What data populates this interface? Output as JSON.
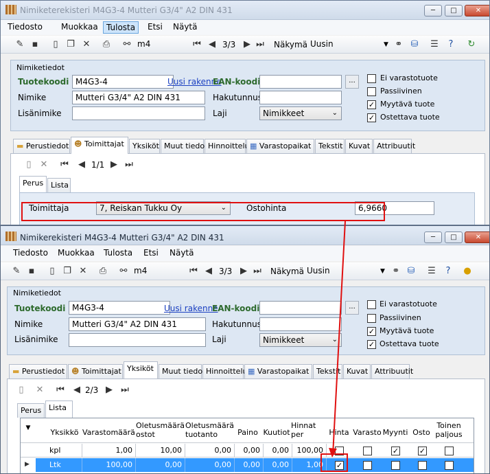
{
  "windows": [
    {
      "title": "Nimiketerekisteri M4G3-4 Mutteri G3/4\" A2 DIN 431",
      "menu": [
        "Tiedosto",
        "Muokkaa",
        "Tulosta",
        "Etsi",
        "Näytä"
      ],
      "toolbar": {
        "search": "m4",
        "pager": "3/3",
        "view_label": "Näkymä",
        "view_value": "Uusin"
      },
      "group_title": "Nimiketiedot",
      "product_code_label": "Tuotekoodi",
      "product_code": "M4G3-4",
      "new_structure": "Uusi rakenne",
      "ean_label": "EAN-koodi",
      "name_label": "Nimike",
      "name": "Mutteri G3/4\" A2 DIN 431",
      "search_name_label": "Hakutunnus",
      "extra_name_label": "Lisänimike",
      "type_label": "Laji",
      "type_value": "Nimikkeet",
      "checks": [
        {
          "label": "Ei varastotuote",
          "checked": false
        },
        {
          "label": "Passiivinen",
          "checked": false
        },
        {
          "label": "Myytävä tuote",
          "checked": true
        },
        {
          "label": "Ostettava tuote",
          "checked": true
        }
      ],
      "tabs": [
        "Perustiedot",
        "Toimittajat",
        "Yksiköt",
        "Muut tiedot",
        "Hinnoittelu",
        "Varastopaikat",
        "Tekstit",
        "Kuvat",
        "Attribuutit"
      ],
      "subpager": "1/1",
      "subtabs": [
        "Perus",
        "Lista"
      ],
      "supplier_label": "Toimittaja",
      "supplier_value": "7, Reiskan Tukku Oy",
      "price_label": "Ostohinta",
      "price_value": "6,9660"
    },
    {
      "title": "Nimikerekisteri M4G3-4 Mutteri G3/4\" A2 DIN 431",
      "menu": [
        "Tiedosto",
        "Muokkaa",
        "Tulosta",
        "Etsi",
        "Näytä"
      ],
      "toolbar": {
        "search": "m4",
        "pager": "3/3",
        "view_label": "Näkymä",
        "view_value": "Uusin"
      },
      "group_title": "Nimiketiedot",
      "product_code_label": "Tuotekoodi",
      "product_code": "M4G3-4",
      "new_structure": "Uusi rakenne",
      "ean_label": "EAN-koodi",
      "name_label": "Nimike",
      "name": "Mutteri G3/4\" A2 DIN 431",
      "search_name_label": "Hakutunnus",
      "extra_name_label": "Lisänimike",
      "type_label": "Laji",
      "type_value": "Nimikkeet",
      "checks": [
        {
          "label": "Ei varastotuote",
          "checked": false
        },
        {
          "label": "Passiivinen",
          "checked": false
        },
        {
          "label": "Myytävä tuote",
          "checked": true
        },
        {
          "label": "Ostettava tuote",
          "checked": true
        }
      ],
      "tabs": [
        "Perustiedot",
        "Toimittajat",
        "Yksiköt",
        "Muut tiedot",
        "Hinnoittelu",
        "Varastopaikat",
        "Tekstit",
        "Kuvat",
        "Attribuutit"
      ],
      "subpager": "2/3",
      "subtabs": [
        "Perus",
        "Lista"
      ],
      "grid": {
        "headers": [
          "Yksikkö",
          "Varastomäärä",
          "Oletusmäärä ostot",
          "Oletusmäärä tuotanto",
          "Paino",
          "Kuutiot",
          "Hinnat per",
          "Hinta",
          "Varasto",
          "Myynti",
          "Osto",
          "Toinen paljous"
        ],
        "rows": [
          {
            "unit": "kpl",
            "stock": "1,00",
            "def_buy": "10,00",
            "def_prod": "0,00",
            "weight": "0,00",
            "volume": "0,00",
            "price_per": "100,00",
            "flags": [
              false,
              false,
              true,
              true,
              false
            ]
          },
          {
            "unit": "Ltk",
            "stock": "100,00",
            "def_buy": "0,00",
            "def_prod": "0,00",
            "weight": "0,00",
            "volume": "0,00",
            "price_per": "1,00",
            "flags": [
              true,
              false,
              false,
              false,
              false
            ]
          }
        ]
      }
    }
  ],
  "colors": {
    "highlight": "#e01010",
    "selected_row": "#3399ff"
  }
}
